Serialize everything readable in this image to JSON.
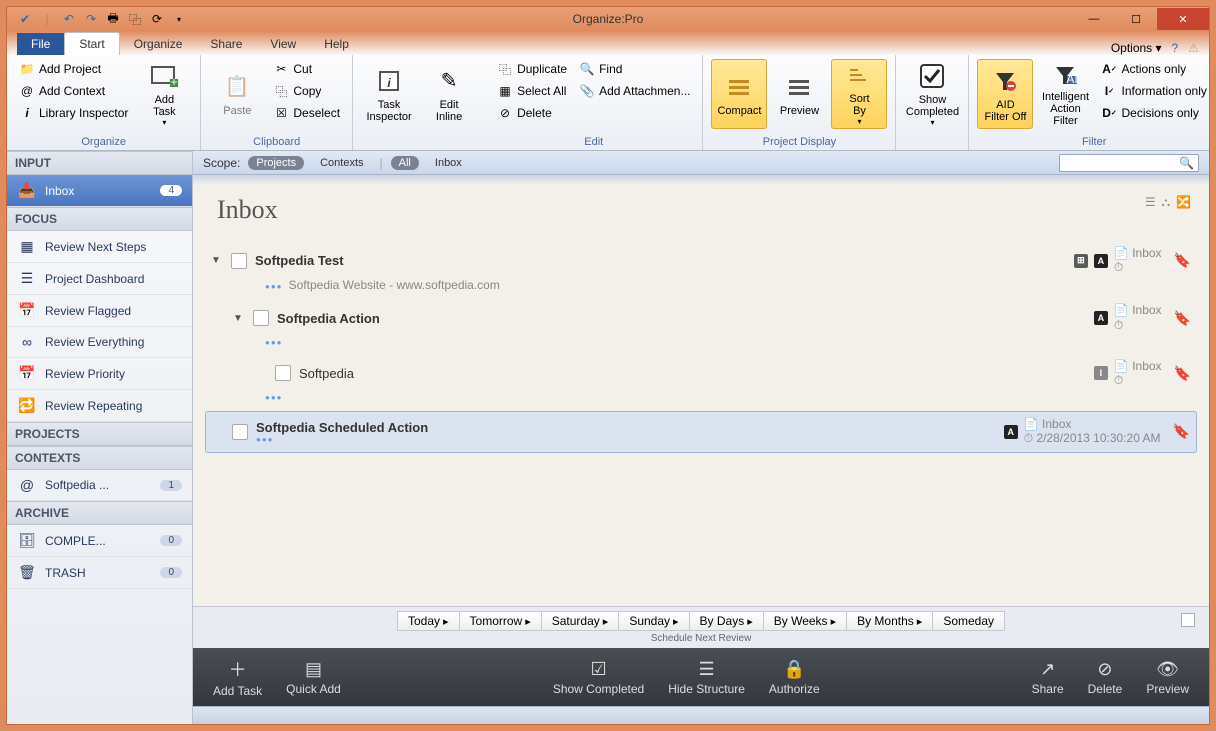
{
  "app": {
    "title": "Organize:Pro"
  },
  "win": {
    "options": "Options"
  },
  "tabs": {
    "file": "File",
    "start": "Start",
    "organize": "Organize",
    "share": "Share",
    "view": "View",
    "help": "Help"
  },
  "ribbon": {
    "organize": {
      "label": "Organize",
      "add_project": "Add Project",
      "add_context": "Add Context",
      "library_inspector": "Library Inspector",
      "add_task": "Add\nTask"
    },
    "clipboard": {
      "label": "Clipboard",
      "paste": "Paste",
      "cut": "Cut",
      "copy": "Copy",
      "deselect": "Deselect"
    },
    "inspect": {
      "task_inspector": "Task\nInspector",
      "edit_inline": "Edit\nInline"
    },
    "edit": {
      "label": "Edit",
      "duplicate": "Duplicate",
      "select_all": "Select All",
      "delete": "Delete",
      "find": "Find",
      "add_attachment": "Add Attachmen..."
    },
    "display": {
      "label": "Project Display",
      "compact": "Compact",
      "preview": "Preview",
      "sort_by": "Sort\nBy"
    },
    "completed": {
      "show_completed": "Show\nCompleted"
    },
    "filter": {
      "label": "Filter",
      "aid_off": "AID\nFilter Off",
      "intelligent": "Intelligent\nAction Filter",
      "actions_only": "Actions only",
      "information_only": "Information only",
      "decisions_only": "Decisions only"
    }
  },
  "scope": {
    "label": "Scope:",
    "projects": "Projects",
    "contexts": "Contexts",
    "all": "All",
    "inbox": "Inbox"
  },
  "sidebar": {
    "input": {
      "label": "INPUT",
      "inbox": "Inbox",
      "inbox_count": "4"
    },
    "focus": {
      "label": "FOCUS",
      "next_steps": "Review Next Steps",
      "dashboard": "Project Dashboard",
      "flagged": "Review Flagged",
      "everything": "Review Everything",
      "priority": "Review Priority",
      "repeating": "Review Repeating"
    },
    "projects": {
      "label": "PROJECTS"
    },
    "contexts": {
      "label": "CONTEXTS",
      "softpedia": "Softpedia ...",
      "count": "1"
    },
    "archive": {
      "label": "ARCHIVE",
      "completed": "COMPLE...",
      "completed_count": "0",
      "trash": "TRASH",
      "trash_count": "0"
    }
  },
  "page": {
    "title": "Inbox"
  },
  "tasks": {
    "t1": {
      "title": "Softpedia Test",
      "sub": "Softpedia Website - www.softpedia.com",
      "loc": "Inbox"
    },
    "t2": {
      "title": "Softpedia Action",
      "loc": "Inbox"
    },
    "t3": {
      "title": "Softpedia",
      "loc": "Inbox"
    },
    "t4": {
      "title": "Softpedia Scheduled Action",
      "loc": "Inbox",
      "date": "2/28/2013 10:30:20 AM"
    }
  },
  "schedule": {
    "today": "Today",
    "tomorrow": "Tomorrow",
    "saturday": "Saturday",
    "sunday": "Sunday",
    "by_days": "By Days",
    "by_weeks": "By Weeks",
    "by_months": "By Months",
    "someday": "Someday",
    "label": "Schedule Next Review"
  },
  "actions": {
    "add_task": "Add Task",
    "quick_add": "Quick Add",
    "show_completed": "Show Completed",
    "hide_structure": "Hide Structure",
    "authorize": "Authorize",
    "share": "Share",
    "delete": "Delete",
    "preview": "Preview"
  }
}
